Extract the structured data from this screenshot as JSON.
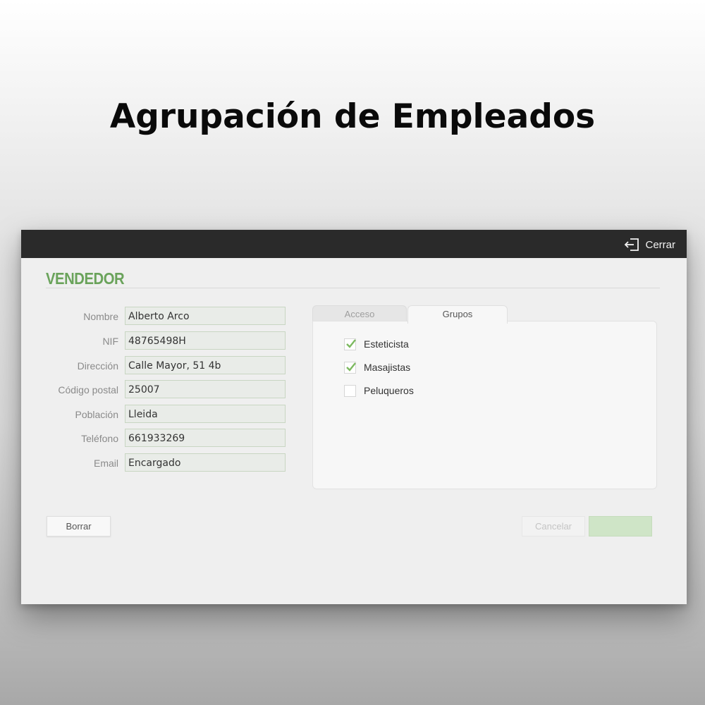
{
  "page": {
    "title": "Agrupación de Empleados"
  },
  "window": {
    "close_label": "Cerrar",
    "section_title": "VENDEDOR"
  },
  "form": {
    "fields": [
      {
        "label": "Nombre",
        "value": "Alberto Arco"
      },
      {
        "label": "NIF",
        "value": "48765498H"
      },
      {
        "label": "Dirección",
        "value": "Calle Mayor, 51 4b"
      },
      {
        "label": "Código postal",
        "value": "25007"
      },
      {
        "label": "Población",
        "value": "Lleida"
      },
      {
        "label": "Teléfono",
        "value": "661933269"
      },
      {
        "label": "Email",
        "value": "Encargado"
      }
    ]
  },
  "tabs": {
    "items": [
      {
        "label": "Acceso",
        "active": false
      },
      {
        "label": "Grupos",
        "active": true
      }
    ]
  },
  "groups": {
    "items": [
      {
        "label": "Esteticista",
        "checked": true
      },
      {
        "label": "Masajistas",
        "checked": true
      },
      {
        "label": "Peluqueros",
        "checked": false
      }
    ]
  },
  "buttons": {
    "delete_label": "Borrar",
    "cancel_label": "Cancelar"
  },
  "colors": {
    "accent": "#6aa35b",
    "topbar": "#2a2a2a",
    "check": "#7cb95f"
  }
}
